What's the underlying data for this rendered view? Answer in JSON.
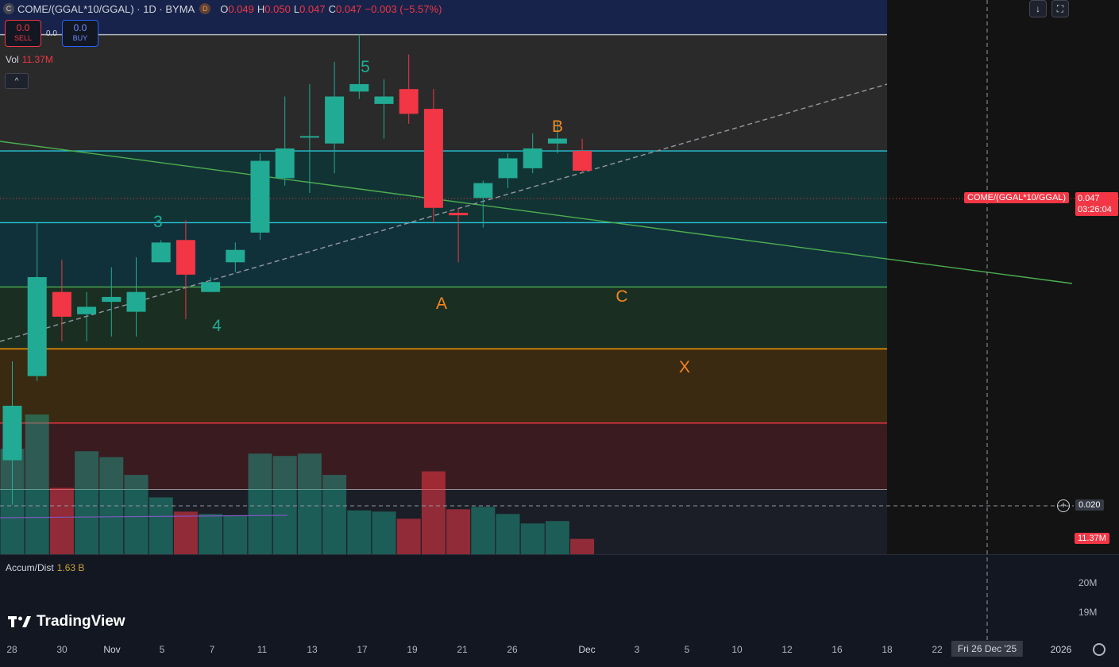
{
  "header": {
    "symbol_badge": "C",
    "title": "COME/(GGAL*10/GGAL) · 1D · BYMA",
    "delayed_badge": "D",
    "ohlc": [
      {
        "k": "O",
        "v": "0.049"
      },
      {
        "k": "H",
        "v": "0.050"
      },
      {
        "k": "L",
        "v": "0.047"
      },
      {
        "k": "C",
        "v": "0.047"
      }
    ],
    "change": "−0.003 (−5.57%)"
  },
  "trade": {
    "sell_price": "0.0",
    "sell_label": "SELL",
    "spread": "0.0",
    "buy_price": "0.0",
    "buy_label": "BUY"
  },
  "volume_legend": {
    "label": "Vol",
    "value": "11.37M"
  },
  "accum_legend": {
    "label": "Accum/Dist",
    "value": "1.63 B"
  },
  "buttons": {
    "collapse": "^",
    "download": "↓",
    "fullscreen": "⛶"
  },
  "price_axis": {
    "symbol_tag": "COME/(GGAL*10/GGAL)",
    "last_price": "0.047",
    "countdown": "03:26:04",
    "crosshair_price": "0.020",
    "volume_tag": "11.37M",
    "lower_ticks": [
      "20M",
      "19M"
    ]
  },
  "crosshair_date": "Fri 26 Dec '25",
  "x_axis_labels": [
    "28",
    "30",
    "Nov",
    "5",
    "7",
    "11",
    "13",
    "17",
    "19",
    "21",
    "26",
    "Dec",
    "3",
    "5",
    "10",
    "12",
    "16",
    "18",
    "22",
    "2026"
  ],
  "wave_labels": [
    {
      "text": "5",
      "color": "#22ab94"
    },
    {
      "text": "3",
      "color": "#22ab94"
    },
    {
      "text": "4",
      "color": "#22ab94"
    },
    {
      "text": "B",
      "color": "#f7861f"
    },
    {
      "text": "A",
      "color": "#f7861f"
    },
    {
      "text": "C",
      "color": "#f7861f"
    },
    {
      "text": "X",
      "color": "#f7861f"
    }
  ],
  "logo_text": "TradingView",
  "colors": {
    "up": "#22ab94",
    "down": "#f23645",
    "background": "#131722"
  },
  "chart_data": {
    "type": "candlestick",
    "title": "COME/(GGAL*10/GGAL) · 1D · BYMA",
    "x": [
      "Oct 28",
      "Oct 29",
      "Oct 30",
      "Oct 31",
      "Nov 3",
      "Nov 4",
      "Nov 5",
      "Nov 6",
      "Nov 7",
      "Nov 10",
      "Nov 11",
      "Nov 12",
      "Nov 13",
      "Nov 14",
      "Nov 17",
      "Nov 18",
      "Nov 19",
      "Nov 20",
      "Nov 21",
      "Nov 24",
      "Nov 25",
      "Nov 26",
      "Nov 27",
      "Nov 28"
    ],
    "ohlc": [
      [
        0.0366,
        0.0406,
        0.0348,
        0.0388
      ],
      [
        0.04,
        0.0462,
        0.0398,
        0.044
      ],
      [
        0.0434,
        0.0447,
        0.0414,
        0.0424
      ],
      [
        0.0425,
        0.0434,
        0.0414,
        0.0428
      ],
      [
        0.043,
        0.0444,
        0.0416,
        0.0432
      ],
      [
        0.0426,
        0.0448,
        0.0416,
        0.0434
      ],
      [
        0.0446,
        0.0455,
        0.0446,
        0.0454
      ],
      [
        0.0455,
        0.0463,
        0.0423,
        0.0441
      ],
      [
        0.0434,
        0.044,
        0.0434,
        0.0438
      ],
      [
        0.0446,
        0.0454,
        0.0442,
        0.0451
      ],
      [
        0.0458,
        0.049,
        0.0455,
        0.0487
      ],
      [
        0.048,
        0.0513,
        0.0477,
        0.0492
      ],
      [
        0.0497,
        0.0518,
        0.0474,
        0.0497
      ],
      [
        0.0494,
        0.0527,
        0.0482,
        0.0513
      ],
      [
        0.0515,
        0.0538,
        0.0512,
        0.0518
      ],
      [
        0.051,
        0.052,
        0.0496,
        0.0513
      ],
      [
        0.0516,
        0.053,
        0.0502,
        0.0506
      ],
      [
        0.0508,
        0.0516,
        0.0462,
        0.0468
      ],
      [
        0.0466,
        0.0468,
        0.0446,
        0.0465
      ],
      [
        0.0472,
        0.0479,
        0.046,
        0.0478
      ],
      [
        0.048,
        0.049,
        0.0476,
        0.0488
      ],
      [
        0.0484,
        0.0498,
        0.0482,
        0.0492
      ],
      [
        0.0494,
        0.0503,
        0.049,
        0.0496
      ],
      [
        0.0491,
        0.0496,
        0.0482,
        0.0483
      ]
    ],
    "volume": [
      8.9,
      11.8,
      5.6,
      8.7,
      8.2,
      6.7,
      4.8,
      3.6,
      3.4,
      3.3,
      8.5,
      8.3,
      8.5,
      6.7,
      3.7,
      3.6,
      3.0,
      7.0,
      3.8,
      4.0,
      3.4,
      2.6,
      2.8,
      1.3
    ],
    "volume_direction": [
      "up",
      "up",
      "down",
      "up",
      "up",
      "up",
      "up",
      "down",
      "up",
      "up",
      "up",
      "up",
      "up",
      "up",
      "up",
      "up",
      "down",
      "down",
      "down",
      "up",
      "up",
      "up",
      "up",
      "down"
    ],
    "horizontal_levels": [
      0.0538,
      0.0491,
      0.0462,
      0.0436,
      0.0411,
      0.0381,
      0.0354
    ],
    "ylim": [
      0.0328,
      0.0552
    ]
  }
}
